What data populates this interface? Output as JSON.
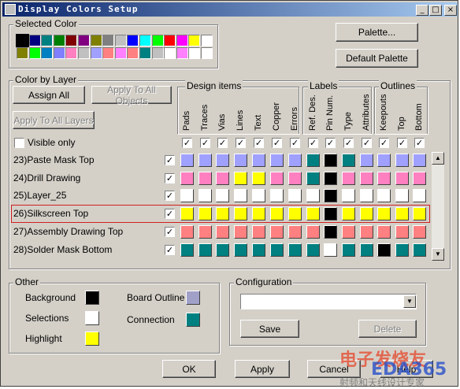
{
  "window": {
    "title": "Display Colors Setup",
    "minimize": "_",
    "maximize": "□",
    "close": "×"
  },
  "selected_color": {
    "title": "Selected Color",
    "row1": [
      "#000000",
      "#000080",
      "#008080",
      "#008000",
      "#800000",
      "#800080",
      "#808000",
      "#808080",
      "#c0c0c0",
      "#0000ff",
      "#00ffff",
      "#00ff00",
      "#ff0000",
      "#ff00ff",
      "#ffff00",
      "#ffffff"
    ],
    "row2": [
      "#808000",
      "#00ff00",
      "#0080c0",
      "#8080ff",
      "#ff80c0",
      "#c0c0c0",
      "#a0a0ff",
      "#ff8080",
      "#ff80ff",
      "#ff8080",
      "#008080",
      "#c0c0c0",
      "#ffffff",
      "#ff80ff",
      "#ffffff",
      "#ffffff"
    ]
  },
  "buttons": {
    "palette": "Palette...",
    "default_palette": "Default Palette",
    "assign_all": "Assign All",
    "apply_to_all_objects": "Apply To All Objects",
    "apply_to_all_layers": "Apply To All Layers",
    "save": "Save",
    "delete": "Delete",
    "ok": "OK",
    "apply": "Apply",
    "cancel": "Cancel",
    "help": "Help"
  },
  "color_by_layer": {
    "title": "Color by Layer",
    "groups": {
      "design": "Design items",
      "labels": "Labels",
      "outlines": "Outlines"
    },
    "columns": [
      "Pads",
      "Traces",
      "Vias",
      "Lines",
      "Text",
      "Copper",
      "Errors",
      "Ref. Des.",
      "Pin Num.",
      "Type",
      "Attributes",
      "Keepouts",
      "Top",
      "Bottom"
    ],
    "visible_only": "Visible only",
    "rows": [
      {
        "label": "23)Paste Mask Top",
        "colors": [
          "#a0a0ff",
          "#a0a0ff",
          "#a0a0ff",
          "#a0a0ff",
          "#a0a0ff",
          "#a0a0ff",
          "#a0a0ff",
          "#008080",
          "#000000",
          "#008080",
          "#a0a0ff",
          "#a0a0ff",
          "#a0a0ff",
          "#a0a0ff"
        ]
      },
      {
        "label": "24)Drill Drawing",
        "colors": [
          "#ff80c0",
          "#ff80c0",
          "#ff80c0",
          "#ffff00",
          "#ffff00",
          "#ff80c0",
          "#ff80c0",
          "#008080",
          "#000000",
          "#ff80c0",
          "#ff80c0",
          "#ff80c0",
          "#ff80c0",
          "#ff80c0"
        ]
      },
      {
        "label": "25)Layer_25",
        "colors": [
          "#ffffff",
          "#ffffff",
          "#ffffff",
          "#ffffff",
          "#ffffff",
          "#ffffff",
          "#ffffff",
          "#ffffff",
          "#000000",
          "#ffffff",
          "#ffffff",
          "#ffffff",
          "#ffffff",
          "#ffffff"
        ]
      },
      {
        "label": "26)Silkscreen Top",
        "colors": [
          "#ffff00",
          "#ffff00",
          "#ffff00",
          "#ffff00",
          "#ffff00",
          "#ffff00",
          "#ffff00",
          "#ffff00",
          "#000000",
          "#ffff00",
          "#ffff00",
          "#ffff00",
          "#ffff00",
          "#ffff00"
        ]
      },
      {
        "label": "27)Assembly Drawing Top",
        "colors": [
          "#ff8080",
          "#ff8080",
          "#ff8080",
          "#ff8080",
          "#ff8080",
          "#ff8080",
          "#ff8080",
          "#ff8080",
          "#000000",
          "#ff8080",
          "#ff8080",
          "#ff8080",
          "#ff8080",
          "#ff8080"
        ]
      },
      {
        "label": "28)Solder Mask Bottom",
        "colors": [
          "#008080",
          "#008080",
          "#008080",
          "#008080",
          "#008080",
          "#008080",
          "#008080",
          "#008080",
          "#ffffff",
          "#008080",
          "#008080",
          "#000000",
          "#008080",
          "#008080"
        ]
      }
    ],
    "highlight_color": "#d02020"
  },
  "other": {
    "title": "Other",
    "items": [
      {
        "label": "Background",
        "color": "#000000"
      },
      {
        "label": "Selections",
        "color": "#ffffff"
      },
      {
        "label": "Highlight",
        "color": "#ffff00"
      },
      {
        "label": "Board Outline",
        "color": "#a0a0c8"
      },
      {
        "label": "Connection",
        "color": "#008080"
      }
    ]
  },
  "configuration": {
    "title": "Configuration",
    "value": ""
  },
  "watermark": {
    "line1": "电子发烧友",
    "line2": "EDA365",
    "line3": "射频和天线设计专家"
  }
}
